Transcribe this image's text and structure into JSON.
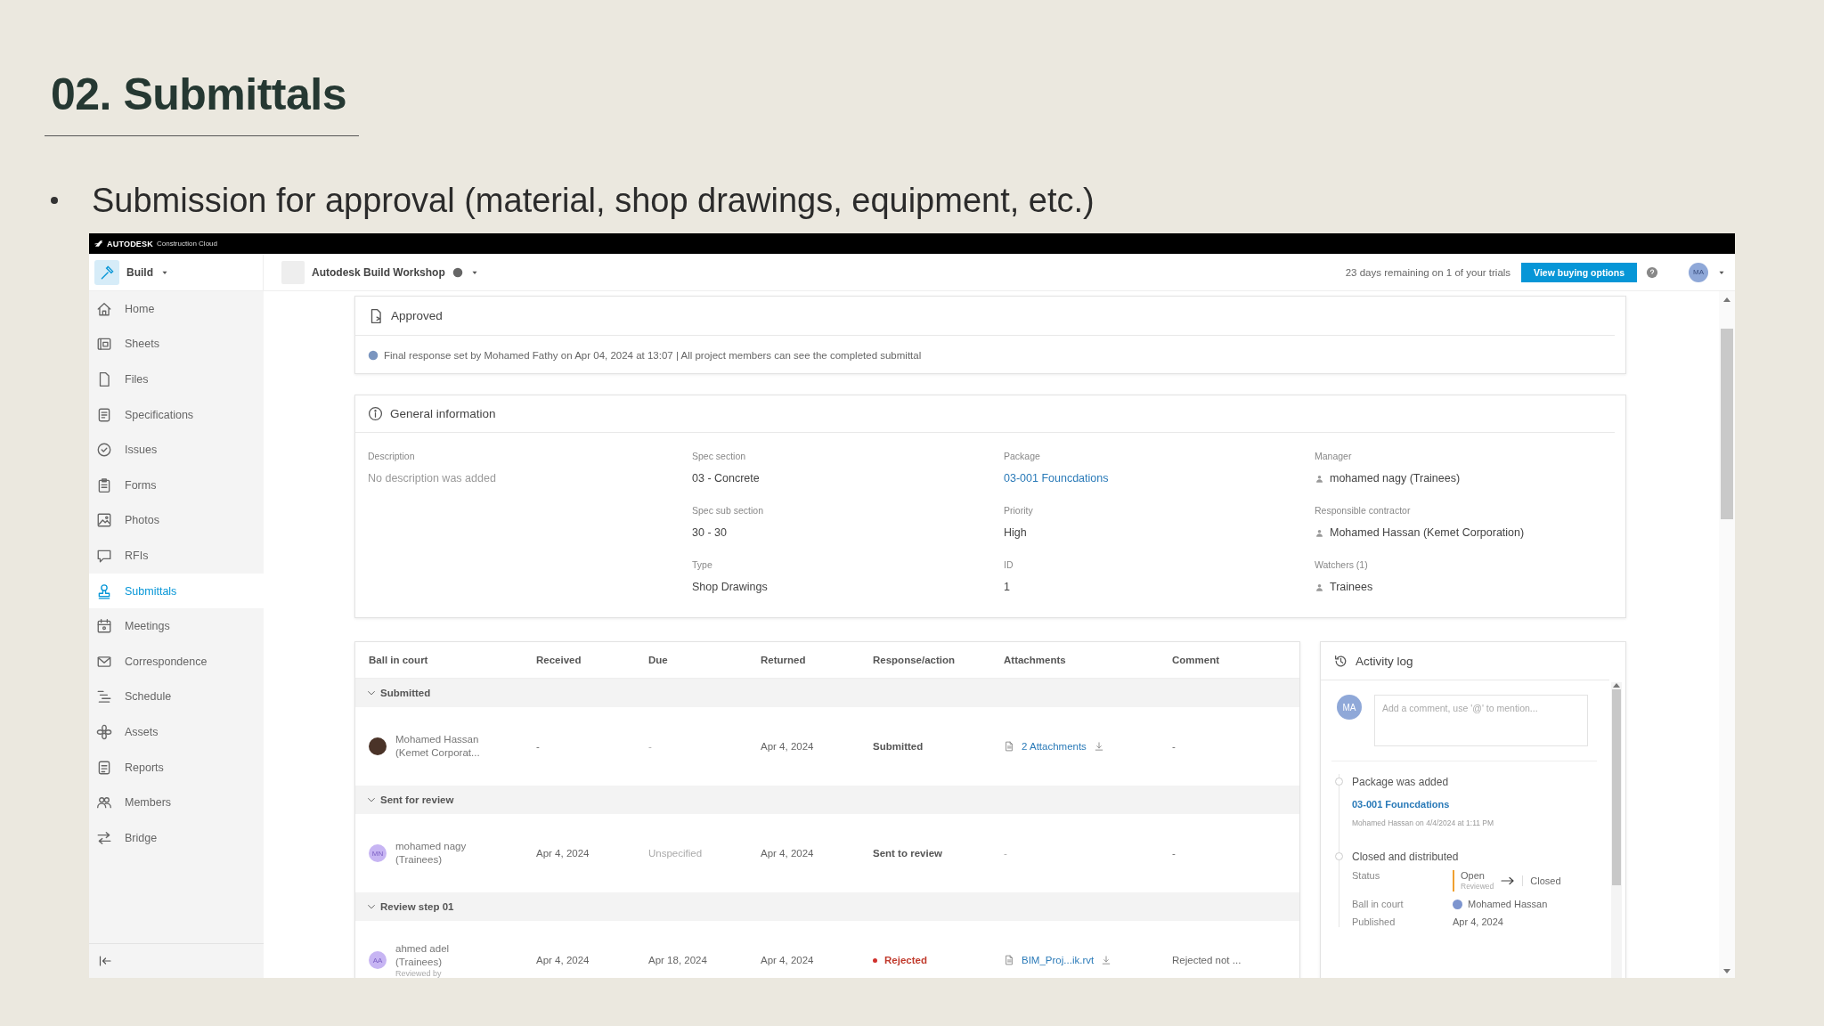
{
  "slide": {
    "title": "02. Submittals",
    "bullet": "Submission for approval (material, shop drawings, equipment, etc.)"
  },
  "brand_bar": {
    "company": "AUTODESK",
    "product": "Construction Cloud"
  },
  "header": {
    "module": "Build",
    "project": "Autodesk Build Workshop",
    "trial_notice": "23 days remaining on 1 of your trials",
    "buy_button": "View buying options",
    "user_initials": "MA"
  },
  "sidebar": {
    "items": [
      {
        "label": "Home",
        "selected": false
      },
      {
        "label": "Sheets",
        "selected": false
      },
      {
        "label": "Files",
        "selected": false
      },
      {
        "label": "Specifications",
        "selected": false
      },
      {
        "label": "Issues",
        "selected": false
      },
      {
        "label": "Forms",
        "selected": false
      },
      {
        "label": "Photos",
        "selected": false
      },
      {
        "label": "RFIs",
        "selected": false
      },
      {
        "label": "Submittals",
        "selected": true
      },
      {
        "label": "Meetings",
        "selected": false
      },
      {
        "label": "Correspondence",
        "selected": false
      },
      {
        "label": "Schedule",
        "selected": false
      },
      {
        "label": "Assets",
        "selected": false
      },
      {
        "label": "Reports",
        "selected": false
      },
      {
        "label": "Members",
        "selected": false
      },
      {
        "label": "Bridge",
        "selected": false
      }
    ]
  },
  "status_card": {
    "title": "Approved",
    "message": "Final response set by Mohamed Fathy on Apr 04, 2024 at 13:07 | All project members can see the completed submittal"
  },
  "general_information": {
    "title": "General information",
    "columns": [
      {
        "fields": [
          {
            "label": "Description",
            "value": "No description was added",
            "kind": "muted"
          }
        ]
      },
      {
        "fields": [
          {
            "label": "Spec section",
            "value": "03 - Concrete",
            "kind": "text"
          },
          {
            "label": "Spec sub section",
            "value": "30 - 30",
            "kind": "text"
          },
          {
            "label": "Type",
            "value": "Shop Drawings",
            "kind": "text"
          }
        ]
      },
      {
        "fields": [
          {
            "label": "Package",
            "value": "03-001 Founcdations",
            "kind": "link"
          },
          {
            "label": "Priority",
            "value": "High",
            "kind": "text"
          },
          {
            "label": "ID",
            "value": "1",
            "kind": "text"
          }
        ]
      },
      {
        "fields": [
          {
            "label": "Manager",
            "value": "mohamed nagy (Trainees)",
            "kind": "person"
          },
          {
            "label": "Responsible contractor",
            "value": "Mohamed Hassan (Kemet Corporation)",
            "kind": "person"
          },
          {
            "label": "Watchers (1)",
            "value": "Trainees",
            "kind": "group"
          }
        ]
      }
    ]
  },
  "workflow_table": {
    "columns": [
      "Ball in court",
      "Received",
      "Due",
      "Returned",
      "Response/action",
      "Attachments",
      "Comment"
    ],
    "groups": [
      {
        "title": "Submitted",
        "expanded": true,
        "rows": [
          {
            "avatar": {
              "kind": "photo"
            },
            "name": "Mohamed Hassan",
            "team": "(Kemet Corporat...",
            "received": "-",
            "due": "-",
            "due_muted": true,
            "returned": "Apr 4, 2024",
            "response": {
              "text": "Submitted",
              "kind": "plain"
            },
            "attachment": {
              "text": "2 Attachments",
              "kind": "link"
            },
            "comment": "-"
          }
        ]
      },
      {
        "title": "Sent for review",
        "expanded": true,
        "rows": [
          {
            "avatar": {
              "kind": "initials",
              "initials": "MN"
            },
            "name": "mohamed nagy",
            "team": "(Trainees)",
            "received": "Apr 4, 2024",
            "due": "Unspecified",
            "due_muted": true,
            "returned": "Apr 4, 2024",
            "response": {
              "text": "Sent to review",
              "kind": "plain"
            },
            "attachment": {
              "text": "-",
              "kind": "none"
            },
            "comment": "-"
          }
        ]
      },
      {
        "title": "Review step 01",
        "expanded": true,
        "rows": [
          {
            "avatar": {
              "kind": "initials",
              "initials": "AA"
            },
            "name": "ahmed adel",
            "team": "(Trainees)",
            "note": "Reviewed by",
            "received": "Apr 4, 2024",
            "due": "Apr 18, 2024",
            "due_muted": false,
            "returned": "Apr 4, 2024",
            "response": {
              "text": "Rejected",
              "kind": "rejected"
            },
            "attachment": {
              "text": "BIM_Proj...ik.rvt",
              "kind": "file"
            },
            "comment": "Rejected not ..."
          }
        ]
      }
    ]
  },
  "activity_log": {
    "title": "Activity log",
    "commenter_initials": "MA",
    "comment_placeholder": "Add a comment, use '@' to mention...",
    "entries": [
      {
        "kind": "link",
        "title": "Package was added",
        "link": "03-001 Founcdations",
        "meta": "Mohamed Hassan on 4/4/2024 at 1:11 PM"
      },
      {
        "kind": "changes",
        "title": "Closed and distributed",
        "details": [
          {
            "kind": "status",
            "label": "Status",
            "from": "Open",
            "from_note": "Reviewed",
            "to": "Closed"
          },
          {
            "kind": "person",
            "label": "Ball in court",
            "value": "Mohamed Hassan"
          },
          {
            "kind": "text",
            "label": "Published",
            "value": "Apr 4, 2024"
          }
        ]
      }
    ]
  }
}
